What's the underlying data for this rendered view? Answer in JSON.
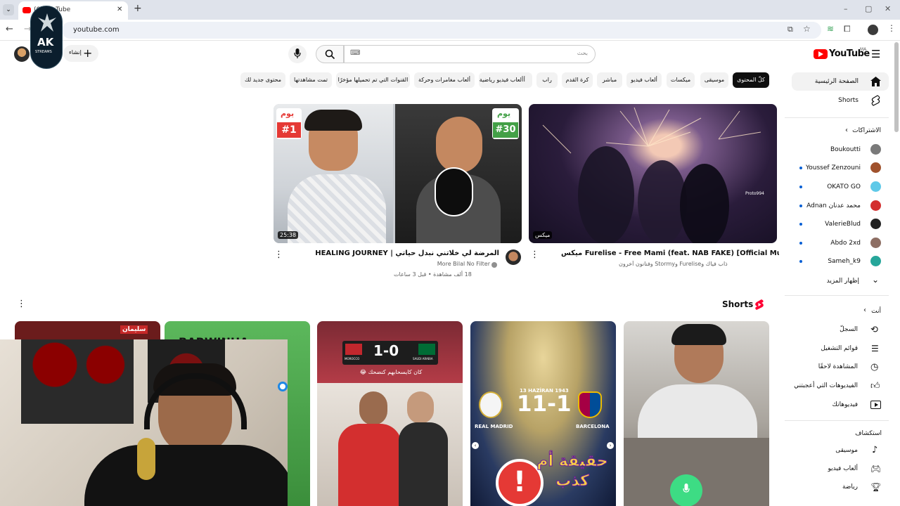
{
  "browser": {
    "tab_title": "(6) YouTube",
    "url": "youtube.com",
    "tab_close": "✕",
    "new_tab": "+"
  },
  "masthead": {
    "logo_text": "YouTube",
    "region": "MA",
    "search_placeholder": "بحث",
    "create_label": "إنشاء"
  },
  "overlay_logo": {
    "text": "AK",
    "subtext": "STREAMS"
  },
  "chips": [
    {
      "label": "كلّ المحتوى"
    },
    {
      "label": "موسيقى"
    },
    {
      "label": "ميكسات"
    },
    {
      "label": "ألعاب فيديو"
    },
    {
      "label": "مباشر"
    },
    {
      "label": "كرة القدم"
    },
    {
      "label": "راب"
    },
    {
      "label": "ألعاب فيديو"
    },
    {
      "label": "ألعاب فيديو رياضية"
    },
    {
      "label": "ألعاب مغامرات وحركة"
    },
    {
      "label": "القنوات التي تم تحميلها مؤخرًا"
    },
    {
      "label": "تمت مشاهدتها"
    },
    {
      "label": "محتوى جديد لك"
    }
  ],
  "videos": [
    {
      "title": "ميكس Furelise - Free Mami (feat. NAB FAKE) [Official Music Video]",
      "meta": "ذاب فياك وFurelise وStormy وفنانون آخرون",
      "badge": "ميكس",
      "chat_user": "Proto994"
    },
    {
      "title": "المرضة لي خلاتني نبدل حياتي | HEALING JOURNEY",
      "channel": "More Bilal No Filter",
      "stats": "18 ألف مشاهدة • قبل 3 ساعات",
      "duration": "25:38",
      "day1": "#1",
      "day30": "#30",
      "day_word": "يوم"
    }
  ],
  "shorts": {
    "title": "Shorts",
    "items": [
      {
        "score": "1-0",
        "team1": "MOROCCO",
        "team2": "SAUDI ARABIA",
        "caption": "كان كايسحابهم كنضحك 😂"
      },
      {
        "score": "11-1",
        "date": "13 HAZİRAN 1943",
        "team1": "REAL MADRID",
        "team2": "BARCELONA",
        "headline": "حقيقة أم كذب"
      },
      {
        "label": "BARWINHA"
      },
      {
        "label": "سليمان"
      }
    ]
  },
  "sidebar": {
    "home": "الصفحة الرئيسية",
    "shorts": "Shorts",
    "subscriptions_header": "الاشتراكات",
    "subscriptions": [
      {
        "name": "Boukoutti",
        "color": "#7a7a7a",
        "dot": false
      },
      {
        "name": "Youssef Zenzouni",
        "color": "#a0522d",
        "dot": true
      },
      {
        "name": "OKATO GO",
        "color": "#5fc9e8",
        "dot": true
      },
      {
        "name": "محمد عدنان Adnan",
        "color": "#d32f2f",
        "dot": true
      },
      {
        "name": "ValerieBlud",
        "color": "#222222",
        "dot": true
      },
      {
        "name": "Abdo 2xd",
        "color": "#8d6e63",
        "dot": true
      },
      {
        "name": "Sameh_k9",
        "color": "#26a69a",
        "dot": true
      }
    ],
    "show_more": "إظهار المزيد",
    "you_header": "أنت",
    "you_items": [
      {
        "label": "السجلّ",
        "icon": "history-icon"
      },
      {
        "label": "قوائم التشغيل",
        "icon": "playlists-icon"
      },
      {
        "label": "المشاهدة لاحقًا",
        "icon": "watch-later-icon"
      },
      {
        "label": "الفيديوهات التي أعجبتني",
        "icon": "liked-icon"
      },
      {
        "label": "فيديوهاتك",
        "icon": "your-videos-icon"
      }
    ],
    "explore_header": "استكشاف",
    "explore_items": [
      {
        "label": "موسيقى",
        "icon": "music-icon"
      },
      {
        "label": "ألعاب فيديو",
        "icon": "gaming-icon"
      },
      {
        "label": "رياضة",
        "icon": "trophy-icon"
      }
    ]
  },
  "colors": {
    "accent": "#ff0000",
    "chip_active": "#0f0f0f",
    "link": "#065fd4"
  }
}
